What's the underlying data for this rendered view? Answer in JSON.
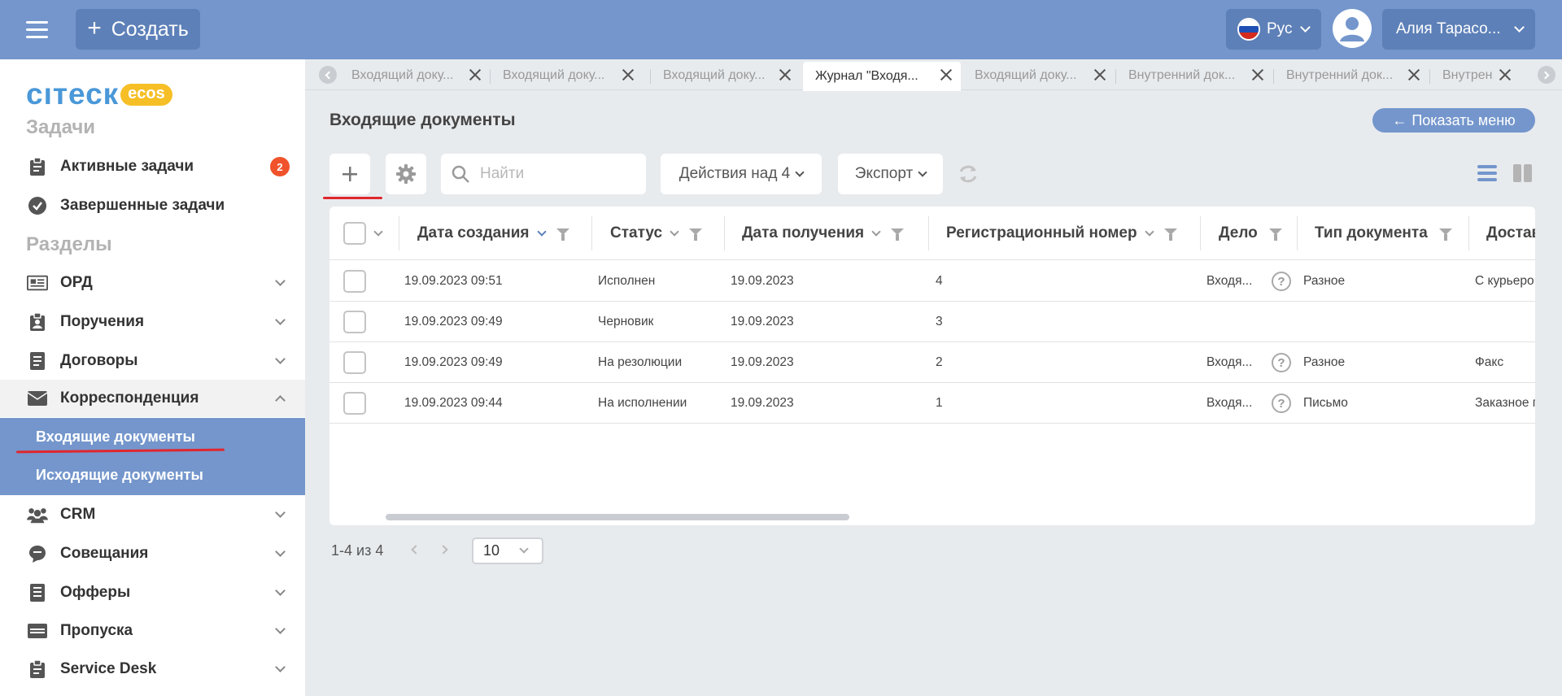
{
  "header": {
    "create_label": "Создать",
    "lang_label": "Рус",
    "user_name": "Алия Тарасо..."
  },
  "sidebar": {
    "logo_text": "cıтеск",
    "logo_badge": "ecos",
    "section_tasks": "Задачи",
    "active_tasks": "Активные задачи",
    "active_tasks_count": "2",
    "completed_tasks": "Завершенные задачи",
    "section_sections": "Разделы",
    "items": [
      {
        "label": "ОРД"
      },
      {
        "label": "Поручения"
      },
      {
        "label": "Договоры"
      },
      {
        "label": "Корреспонденция"
      },
      {
        "label": "CRM"
      },
      {
        "label": "Совещания"
      },
      {
        "label": "Офферы"
      },
      {
        "label": "Пропуска"
      },
      {
        "label": "Service Desk"
      }
    ],
    "sub_items": [
      {
        "label": "Входящие документы"
      },
      {
        "label": "Исходящие документы"
      }
    ]
  },
  "tabs": [
    {
      "label": "Входящий доку..."
    },
    {
      "label": "Входящий доку..."
    },
    {
      "label": "Входящий доку..."
    },
    {
      "label": "Журнал \"Входя..."
    },
    {
      "label": "Входящий доку..."
    },
    {
      "label": "Внутренний док..."
    },
    {
      "label": "Внутренний док..."
    },
    {
      "label": "Внутрен"
    }
  ],
  "main": {
    "title": "Входящие документы",
    "show_menu": "Показать меню",
    "search_placeholder": "Найти",
    "actions_label": "Действия над 4",
    "export_label": "Экспорт"
  },
  "table": {
    "columns": [
      "Дата создания",
      "Статус",
      "Дата получения",
      "Регистрационный номер",
      "Дело",
      "Тип документа",
      "Достав"
    ],
    "rows": [
      [
        "19.09.2023 09:51",
        "Исполнен",
        "19.09.2023",
        "4",
        "Входя...",
        "Разное",
        "С курьеро"
      ],
      [
        "19.09.2023 09:49",
        "Черновик",
        "19.09.2023",
        "3",
        "",
        "",
        ""
      ],
      [
        "19.09.2023 09:49",
        "На резолюции",
        "19.09.2023",
        "2",
        "Входя...",
        "Разное",
        "Факс"
      ],
      [
        "19.09.2023 09:44",
        "На исполнении",
        "19.09.2023",
        "1",
        "Входя...",
        "Письмо",
        "Заказное п"
      ]
    ]
  },
  "pager": {
    "range": "1-4 из 4",
    "per_page": "10"
  },
  "colors": {
    "header_bg": "#7496cc",
    "button_bg": "#5d80b8",
    "badge": "#f0532b",
    "annotation_red": "#e0262d"
  }
}
